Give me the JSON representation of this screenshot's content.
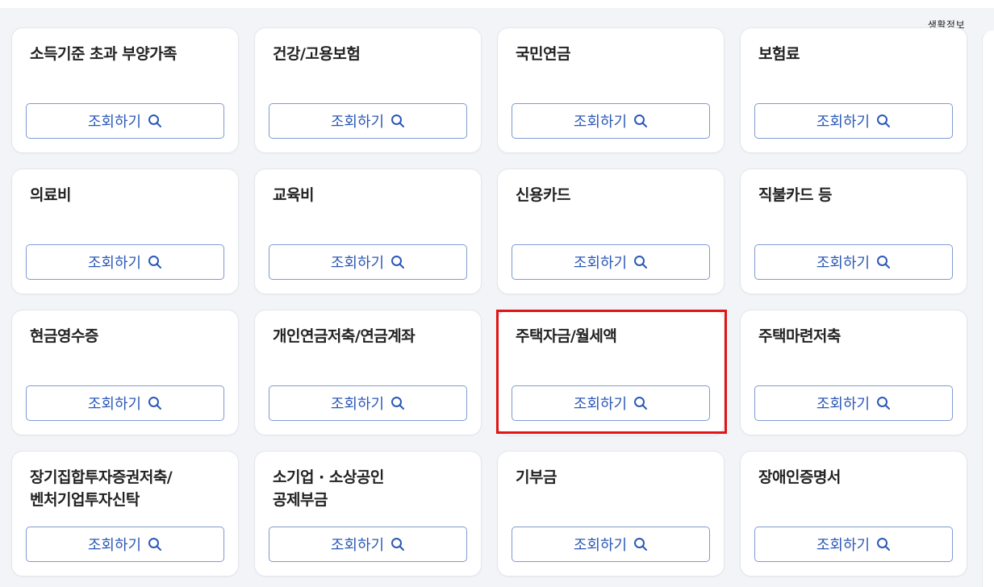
{
  "header": {
    "corner_label": "생활정보"
  },
  "button_label": "조회하기",
  "button_icon": "search-icon",
  "accent_color": "#2b58b7",
  "highlight_color": "#e01515",
  "highlighted_card": "주택자금/월세액",
  "cards": [
    {
      "title": "소득기준 초과 부양가족",
      "button": "조회하기"
    },
    {
      "title": "건강/고용보험",
      "button": "조회하기"
    },
    {
      "title": "국민연금",
      "button": "조회하기"
    },
    {
      "title": "보험료",
      "button": "조회하기"
    },
    {
      "title": "의료비",
      "button": "조회하기"
    },
    {
      "title": "교육비",
      "button": "조회하기"
    },
    {
      "title": "신용카드",
      "button": "조회하기"
    },
    {
      "title": "직불카드 등",
      "button": "조회하기"
    },
    {
      "title": "현금영수증",
      "button": "조회하기"
    },
    {
      "title": "개인연금저축/연금계좌",
      "button": "조회하기"
    },
    {
      "title": "주택자금/월세액",
      "button": "조회하기"
    },
    {
      "title": "주택마련저축",
      "button": "조회하기"
    },
    {
      "title": "장기집합투자증권저축/\n벤처기업투자신탁",
      "button": "조회하기"
    },
    {
      "title": "소기업 · 소상공인\n공제부금",
      "button": "조회하기"
    },
    {
      "title": "기부금",
      "button": "조회하기"
    },
    {
      "title": "장애인증명서",
      "button": "조회하기"
    }
  ]
}
